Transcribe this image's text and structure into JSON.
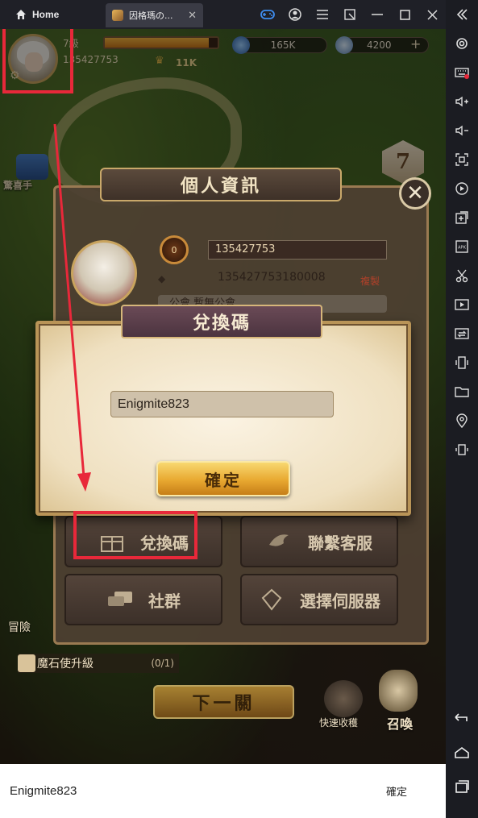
{
  "titlebar": {
    "home_label": "Home",
    "tab_label": "因格瑪の...",
    "tab_close": "✕"
  },
  "hud": {
    "level": "7級",
    "player_id": "135427753",
    "power": "11K",
    "xp_fraction": 0.92,
    "currency1": "165K",
    "currency2": "4200",
    "plus": "+"
  },
  "side": {
    "gift_label": "驚喜手",
    "badge_number": "7",
    "adventure_label": "冒險"
  },
  "info_panel": {
    "title": "個人資訊",
    "close": "✕",
    "rank": "0",
    "player_id": "135427753",
    "number": "135427753180008",
    "copy_label": "複製",
    "guild_label": "公會    暫無公會"
  },
  "redeem_dialog": {
    "title": "兌換碼",
    "input_value": "Enigmite823",
    "confirm_label": "確定"
  },
  "menu": {
    "redeem": "兌換碼",
    "contact": "聯繫客服",
    "community": "社群",
    "server": "選擇伺服器"
  },
  "bottom_hud": {
    "quest_label": "魔石使升級",
    "quest_count": "(0/1)",
    "next_label": "下一關",
    "quick_label": "快速收穫",
    "summon_label": "召喚"
  },
  "ime_bar": {
    "text": "Enigmite823",
    "ok_label": "確定"
  },
  "sidebar_icons": [
    "collapse-icon",
    "settings-icon",
    "keyboard-icon",
    "volume-up-icon",
    "volume-down-icon",
    "screenshot-icon",
    "record-icon",
    "install-icon",
    "apk-icon",
    "cut-icon",
    "media-icon",
    "sync-icon",
    "shake-icon",
    "folder-icon",
    "location-icon",
    "rotate-icon",
    "back-icon",
    "home-icon",
    "recents-icon"
  ],
  "colors": {
    "annotation_red": "#e8283a",
    "confirm_gold": "#e8a830",
    "sidebar_bg": "#1b1c22"
  }
}
